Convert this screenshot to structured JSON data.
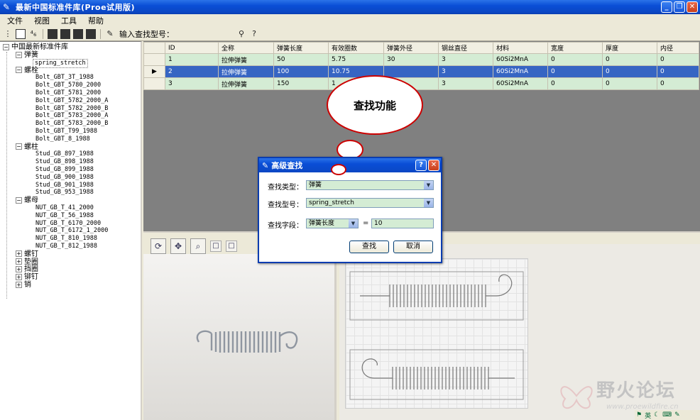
{
  "window": {
    "title": "最新中国标准件库(Proe试用版)"
  },
  "menu": [
    "文件",
    "视图",
    "工具",
    "帮助"
  ],
  "toolbar": {
    "search_label": "输入查找型号："
  },
  "tree": {
    "root": "中国最新标准件库",
    "groups": [
      {
        "label": "弹簧",
        "items": [
          "spring_stretch"
        ]
      },
      {
        "label": "螺栓",
        "items": [
          "Bolt_GBT_3T_1988",
          "Bolt_GBT_5780_2000",
          "Bolt_GBT_5781_2000",
          "Bolt_GBT_5782_2000_A",
          "Bolt_GBT_5782_2000_B",
          "Bolt_GBT_5783_2000_A",
          "Bolt_GBT_5783_2000_B",
          "Bolt_GBT_T99_1988",
          "Bolt_GBT_8_1988"
        ]
      },
      {
        "label": "螺柱",
        "items": [
          "Stud_GB_897_1988",
          "Stud_GB_898_1988",
          "Stud_GB_899_1988",
          "Stud_GB_900_1988",
          "Stud_GB_901_1988",
          "Stud_GB_953_1988"
        ]
      },
      {
        "label": "螺母",
        "items": [
          "NUT_GB_T_41_2000",
          "NUT_GB_T_56_1988",
          "NUT_GB_T_6170_2000",
          "NUT_GB_T_6172_1_2000",
          "NUT_GB_T_810_1988",
          "NUT_GB_T_812_1988"
        ]
      }
    ],
    "collapsed": [
      "螺钉",
      "垫圈",
      "挡圈",
      "铆钉",
      "销"
    ]
  },
  "grid": {
    "columns": [
      "ID",
      "全称",
      "弹簧长度",
      "有效圈数",
      "弹簧外径",
      "钢丝直径",
      "材料",
      "宽度",
      "厚度",
      "内径"
    ],
    "rows": [
      [
        "1",
        "拉伸弹簧",
        "50",
        "5.75",
        "30",
        "3",
        "60Si2MnA",
        "0",
        "0",
        "0"
      ],
      [
        "2",
        "拉伸弹簧",
        "100",
        "10.75",
        "",
        "3",
        "60Si2MnA",
        "0",
        "0",
        "0"
      ],
      [
        "3",
        "拉伸弹簧",
        "150",
        "1",
        "",
        "3",
        "60Si2MnA",
        "0",
        "0",
        "0"
      ]
    ]
  },
  "callout": {
    "text": "查找功能"
  },
  "dialog": {
    "title": "高级查找",
    "type_label": "查找类型：",
    "type_value": "弹簧",
    "model_label": "查找型号：",
    "model_value": "spring_stretch",
    "field_label": "查找字段：",
    "field_value": "弹簧长度",
    "operator": "=",
    "value": "10",
    "find_button": "查找",
    "cancel_button": "取消"
  },
  "watermark": {
    "text": "野火论坛",
    "url": "www.proewildfire.cn"
  },
  "tray": {
    "ime": "英"
  }
}
